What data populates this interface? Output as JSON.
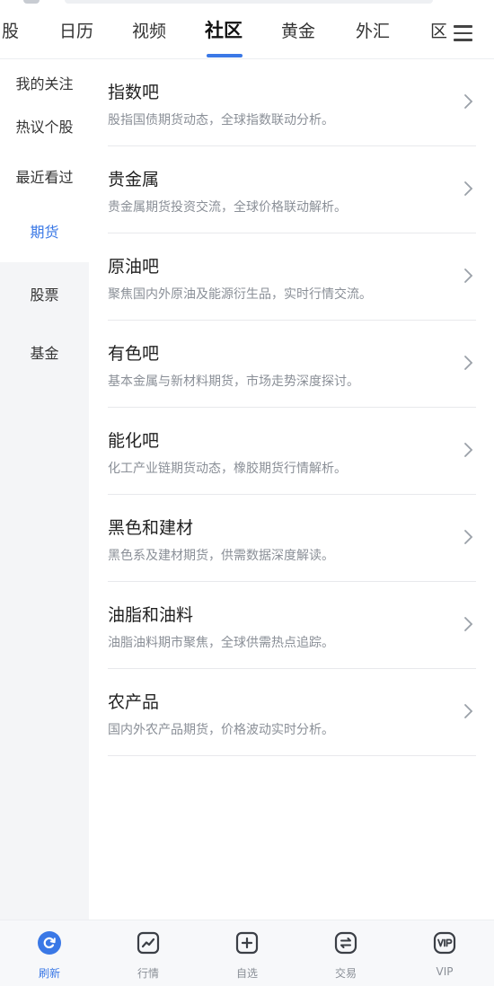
{
  "tabs": [
    {
      "label": "股"
    },
    {
      "label": "日历"
    },
    {
      "label": "视频"
    },
    {
      "label": "社区"
    },
    {
      "label": "黄金"
    },
    {
      "label": "外汇"
    },
    {
      "label": "区"
    }
  ],
  "active_tab": "社区",
  "menu_icon": "hamburger-menu-icon",
  "sidebar": {
    "items": [
      {
        "label": "我的关注"
      },
      {
        "label": "热议个股"
      },
      {
        "label": "最近看过"
      },
      {
        "label": "期货"
      },
      {
        "label": "股票"
      },
      {
        "label": "基金"
      }
    ],
    "active": "期货"
  },
  "list": {
    "items": [
      {
        "title": "指数吧",
        "desc": "股指国债期货动态，全球指数联动分析。"
      },
      {
        "title": "贵金属",
        "desc": "贵金属期货投资交流，全球价格联动解析。"
      },
      {
        "title": "原油吧",
        "desc": "聚焦国内外原油及能源衍生品，实时行情交流。"
      },
      {
        "title": "有色吧",
        "desc": "基本金属与新材料期货，市场走势深度探讨。"
      },
      {
        "title": "能化吧",
        "desc": "化工产业链期货动态，橡胶期货行情解析。"
      },
      {
        "title": "黑色和建材",
        "desc": "黑色系及建材期货，供需数据深度解读。"
      },
      {
        "title": "油脂和油料",
        "desc": "油脂油料期市聚焦，全球供需热点追踪。"
      },
      {
        "title": "农产品",
        "desc": "国内外农产品期货，价格波动实时分析。"
      }
    ]
  },
  "bottom_nav": {
    "items": [
      {
        "label": "刷新",
        "icon": "refresh-icon"
      },
      {
        "label": "行情",
        "icon": "chart-icon"
      },
      {
        "label": "自选",
        "icon": "add-square-icon"
      },
      {
        "label": "交易",
        "icon": "exchange-icon"
      },
      {
        "label": "VIP",
        "icon": "vip-icon"
      }
    ],
    "active": "刷新"
  },
  "colors": {
    "accent": "#3a78e6",
    "text_primary": "#222222",
    "text_secondary": "#8a8f97",
    "sidebar_bg": "#f4f5f7",
    "divider": "#e8e9ec"
  }
}
